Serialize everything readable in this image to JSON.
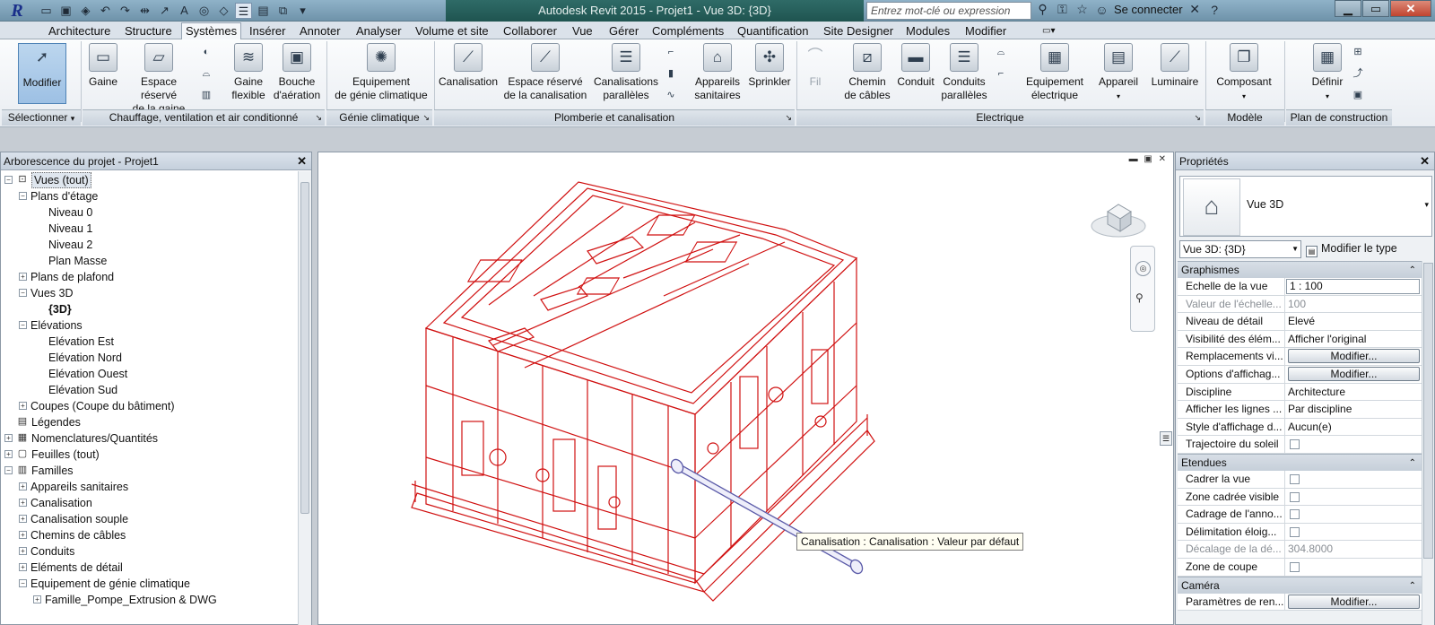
{
  "window": {
    "title": "Autodesk Revit 2015 -    Projet1 - Vue 3D: {3D}",
    "search_placeholder": "Entrez mot-clé ou expression",
    "signin": "Se connecter"
  },
  "tabs": [
    "Architecture",
    "Structure",
    "Systèmes",
    "Insérer",
    "Annoter",
    "Analyser",
    "Volume et site",
    "Collaborer",
    "Vue",
    "Gérer",
    "Compléments",
    "Quantification",
    "Site Designer",
    "Modules",
    "Modifier"
  ],
  "active_tab": "Systèmes",
  "ribbon": {
    "modifier": "Modifier",
    "gaine": "Gaine",
    "espace_gaine_1": "Espace réservé",
    "espace_gaine_2": "de la gaine",
    "gaine_flex_1": "Gaine",
    "gaine_flex_2": "flexible",
    "bouche_1": "Bouche",
    "bouche_2": "d'aération",
    "equip_gc_1": "Equipement",
    "equip_gc_2": "de génie climatique",
    "canalisation": "Canalisation",
    "espace_canal_1": "Espace réservé",
    "espace_canal_2": "de la canalisation",
    "canal_par_1": "Canalisations",
    "canal_par_2": "parallèles",
    "appareils_1": "Appareils",
    "appareils_2": "sanitaires",
    "sprinkler": "Sprinkler",
    "fil": "Fil",
    "chemin_1": "Chemin",
    "chemin_2": "de câbles",
    "conduit": "Conduit",
    "conduits_par_1": "Conduits",
    "conduits_par_2": "parallèles",
    "equip_elec_1": "Equipement",
    "equip_elec_2": "électrique",
    "appareil": "Appareil",
    "luminaire": "Luminaire",
    "composant": "Composant",
    "definir": "Définir",
    "panels": {
      "selectionner": "Sélectionner",
      "chauffage": "Chauffage, ventilation et air conditionné",
      "genie": "Génie climatique",
      "plomberie": "Plomberie et canalisation",
      "electrique": "Electrique",
      "modele": "Modèle",
      "plan": "Plan de construction"
    }
  },
  "project_browser": {
    "title": "Arborescence du projet - Projet1",
    "nodes": [
      {
        "label": "Vues (tout)",
        "level": 0,
        "toggle": "−",
        "selected": true
      },
      {
        "label": "Plans d'étage",
        "level": 1,
        "toggle": "−"
      },
      {
        "label": "Niveau 0",
        "level": 2
      },
      {
        "label": "Niveau 1",
        "level": 2
      },
      {
        "label": "Niveau 2",
        "level": 2
      },
      {
        "label": "Plan Masse",
        "level": 2
      },
      {
        "label": "Plans de plafond",
        "level": 1,
        "toggle": "+"
      },
      {
        "label": "Vues 3D",
        "level": 1,
        "toggle": "−"
      },
      {
        "label": "{3D}",
        "level": 2,
        "bold": true
      },
      {
        "label": "Elévations",
        "level": 1,
        "toggle": "−"
      },
      {
        "label": "Elévation Est",
        "level": 2
      },
      {
        "label": "Elévation Nord",
        "level": 2
      },
      {
        "label": "Elévation Ouest",
        "level": 2
      },
      {
        "label": "Elévation Sud",
        "level": 2
      },
      {
        "label": "Coupes (Coupe du bâtiment)",
        "level": 1,
        "toggle": "+"
      },
      {
        "label": "Légendes",
        "level": 0,
        "icon": "list-icon"
      },
      {
        "label": "Nomenclatures/Quantités",
        "level": 0,
        "toggle": "+",
        "icon": "table-icon"
      },
      {
        "label": "Feuilles (tout)",
        "level": 0,
        "toggle": "+",
        "icon": "sheet-icon"
      },
      {
        "label": "Familles",
        "level": 0,
        "toggle": "−",
        "icon": "family-icon"
      },
      {
        "label": "Appareils sanitaires",
        "level": 1,
        "toggle": "+"
      },
      {
        "label": "Canalisation",
        "level": 1,
        "toggle": "+"
      },
      {
        "label": "Canalisation souple",
        "level": 1,
        "toggle": "+"
      },
      {
        "label": "Chemins de câbles",
        "level": 1,
        "toggle": "+"
      },
      {
        "label": "Conduits",
        "level": 1,
        "toggle": "+"
      },
      {
        "label": "Eléments de détail",
        "level": 1,
        "toggle": "+"
      },
      {
        "label": "Equipement de génie climatique",
        "level": 1,
        "toggle": "−"
      },
      {
        "label": "Famille_Pompe_Extrusion & DWG",
        "level": 2,
        "toggle": "+"
      }
    ]
  },
  "viewport": {
    "tooltip": "Canalisation : Canalisation : Valeur par défaut"
  },
  "properties": {
    "title": "Propriétés",
    "type_name": "Vue 3D",
    "instance": "Vue 3D: {3D}",
    "edit_type": "Modifier le type",
    "sections": {
      "graphismes": "Graphismes",
      "etendues": "Etendues",
      "camera": "Caméra"
    },
    "rows": {
      "echelle_k": "Echelle de la vue",
      "echelle_v": "1 : 100",
      "valeur_k": "Valeur de l'échelle...",
      "valeur_v": "100",
      "niveau_k": "Niveau de détail",
      "niveau_v": "Elevé",
      "visib_k": "Visibilité des élém...",
      "visib_v": "Afficher l'original",
      "rempl_k": "Remplacements vi...",
      "rempl_v": "Modifier...",
      "options_k": "Options d'affichag...",
      "options_v": "Modifier...",
      "disc_k": "Discipline",
      "disc_v": "Architecture",
      "aff_k": "Afficher les lignes ...",
      "aff_v": "Par discipline",
      "style_k": "Style d'affichage d...",
      "style_v": "Aucun(e)",
      "traj_k": "Trajectoire du soleil",
      "cadrer_k": "Cadrer la vue",
      "zone_k": "Zone cadrée visible",
      "cadrage_k": "Cadrage de l'anno...",
      "delim_k": "Délimitation éloig...",
      "decal_k": "Décalage de la dé...",
      "decal_v": "304.8000",
      "zcoupe_k": "Zone de coupe",
      "param_k": "Paramètres de ren...",
      "param_v": "Modifier..."
    }
  },
  "colors": {
    "model_lines": "#d01010",
    "pipe": "#5a5aa8",
    "title_band": "#2a625e"
  }
}
